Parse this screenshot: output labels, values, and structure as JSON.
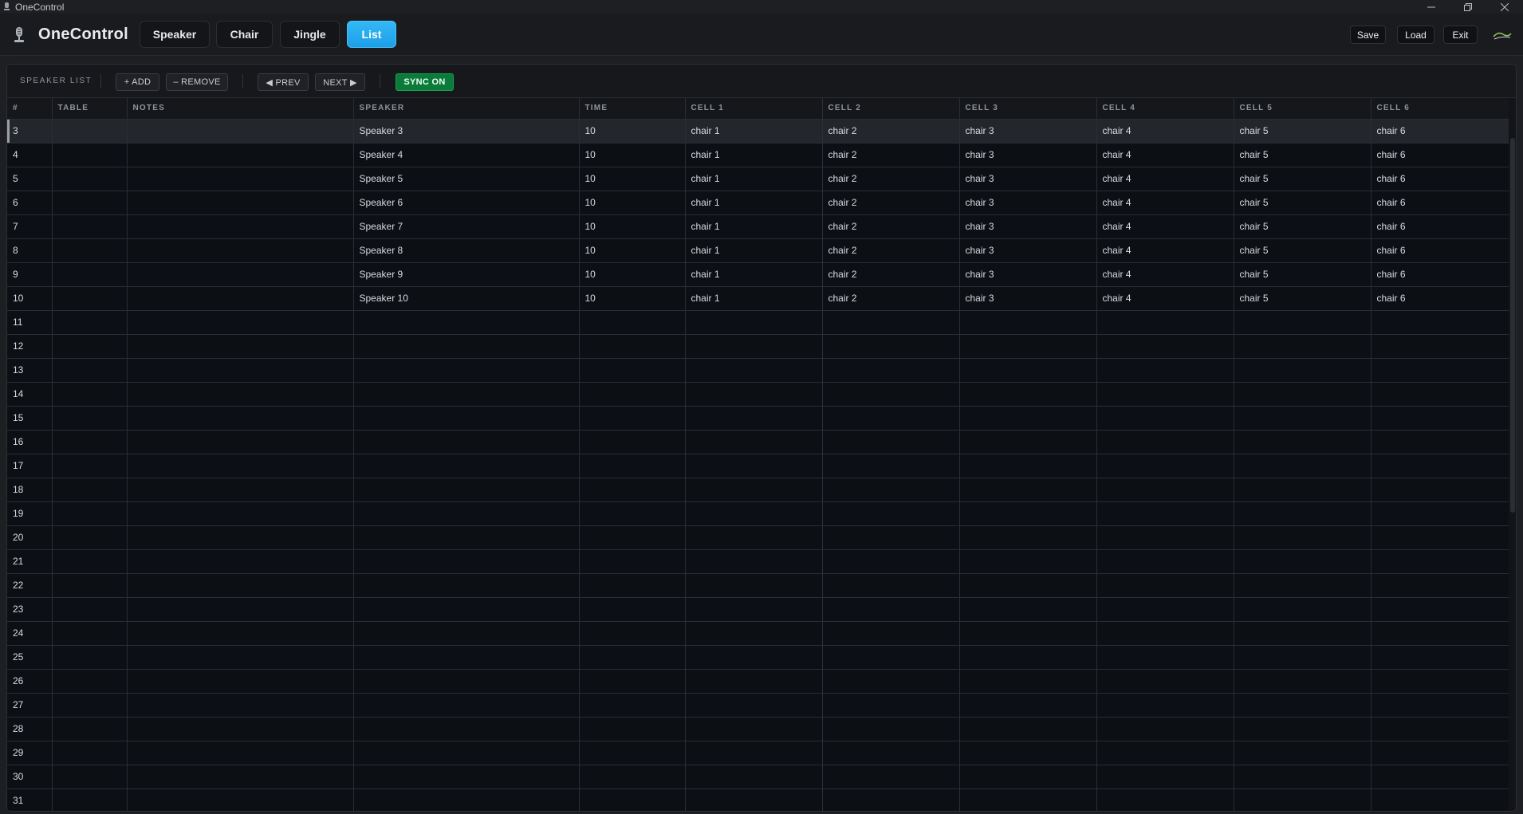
{
  "window": {
    "title": "OneControl",
    "controls": [
      "minimize-icon",
      "restore-icon",
      "close-icon"
    ]
  },
  "header": {
    "brand": "OneControl",
    "tabs": [
      {
        "label": "Speaker",
        "active": false
      },
      {
        "label": "Chair",
        "active": false
      },
      {
        "label": "Jingle",
        "active": false
      },
      {
        "label": "List",
        "active": true
      }
    ],
    "actions": {
      "save": "Save",
      "load": "Load",
      "exit": "Exit"
    }
  },
  "toolbar": {
    "label": "SPEAKER LIST",
    "add": "+ ADD",
    "remove": "– REMOVE",
    "prev": "◀ PREV",
    "next": "NEXT ▶",
    "sync": "SYNC ON"
  },
  "table": {
    "columns": [
      "#",
      "TABLE",
      "NOTES",
      "SPEAKER",
      "TIME",
      "CELL 1",
      "CELL 2",
      "CELL 3",
      "CELL 4",
      "CELL 5",
      "CELL 6"
    ],
    "selected_row": 0,
    "rows": [
      [
        "3",
        "",
        "",
        "Speaker 3",
        "10",
        "chair 1",
        "chair 2",
        "chair 3",
        "chair 4",
        "chair 5",
        "chair 6"
      ],
      [
        "4",
        "",
        "",
        "Speaker 4",
        "10",
        "chair 1",
        "chair 2",
        "chair 3",
        "chair 4",
        "chair 5",
        "chair 6"
      ],
      [
        "5",
        "",
        "",
        "Speaker 5",
        "10",
        "chair 1",
        "chair 2",
        "chair 3",
        "chair 4",
        "chair 5",
        "chair 6"
      ],
      [
        "6",
        "",
        "",
        "Speaker 6",
        "10",
        "chair 1",
        "chair 2",
        "chair 3",
        "chair 4",
        "chair 5",
        "chair 6"
      ],
      [
        "7",
        "",
        "",
        "Speaker 7",
        "10",
        "chair 1",
        "chair 2",
        "chair 3",
        "chair 4",
        "chair 5",
        "chair 6"
      ],
      [
        "8",
        "",
        "",
        "Speaker 8",
        "10",
        "chair 1",
        "chair 2",
        "chair 3",
        "chair 4",
        "chair 5",
        "chair 6"
      ],
      [
        "9",
        "",
        "",
        "Speaker 9",
        "10",
        "chair 1",
        "chair 2",
        "chair 3",
        "chair 4",
        "chair 5",
        "chair 6"
      ],
      [
        "10",
        "",
        "",
        "Speaker 10",
        "10",
        "chair 1",
        "chair 2",
        "chair 3",
        "chair 4",
        "chair 5",
        "chair 6"
      ],
      [
        "11",
        "",
        "",
        "",
        "",
        "",
        "",
        "",
        "",
        "",
        ""
      ],
      [
        "12",
        "",
        "",
        "",
        "",
        "",
        "",
        "",
        "",
        "",
        ""
      ],
      [
        "13",
        "",
        "",
        "",
        "",
        "",
        "",
        "",
        "",
        "",
        ""
      ],
      [
        "14",
        "",
        "",
        "",
        "",
        "",
        "",
        "",
        "",
        "",
        ""
      ],
      [
        "15",
        "",
        "",
        "",
        "",
        "",
        "",
        "",
        "",
        "",
        ""
      ],
      [
        "16",
        "",
        "",
        "",
        "",
        "",
        "",
        "",
        "",
        "",
        ""
      ],
      [
        "17",
        "",
        "",
        "",
        "",
        "",
        "",
        "",
        "",
        "",
        ""
      ],
      [
        "18",
        "",
        "",
        "",
        "",
        "",
        "",
        "",
        "",
        "",
        ""
      ],
      [
        "19",
        "",
        "",
        "",
        "",
        "",
        "",
        "",
        "",
        "",
        ""
      ],
      [
        "20",
        "",
        "",
        "",
        "",
        "",
        "",
        "",
        "",
        "",
        ""
      ],
      [
        "21",
        "",
        "",
        "",
        "",
        "",
        "",
        "",
        "",
        "",
        ""
      ],
      [
        "22",
        "",
        "",
        "",
        "",
        "",
        "",
        "",
        "",
        "",
        ""
      ],
      [
        "23",
        "",
        "",
        "",
        "",
        "",
        "",
        "",
        "",
        "",
        ""
      ],
      [
        "24",
        "",
        "",
        "",
        "",
        "",
        "",
        "",
        "",
        "",
        ""
      ],
      [
        "25",
        "",
        "",
        "",
        "",
        "",
        "",
        "",
        "",
        "",
        ""
      ],
      [
        "26",
        "",
        "",
        "",
        "",
        "",
        "",
        "",
        "",
        "",
        ""
      ],
      [
        "27",
        "",
        "",
        "",
        "",
        "",
        "",
        "",
        "",
        "",
        ""
      ],
      [
        "28",
        "",
        "",
        "",
        "",
        "",
        "",
        "",
        "",
        "",
        ""
      ],
      [
        "29",
        "",
        "",
        "",
        "",
        "",
        "",
        "",
        "",
        "",
        ""
      ],
      [
        "30",
        "",
        "",
        "",
        "",
        "",
        "",
        "",
        "",
        "",
        ""
      ],
      [
        "31",
        "",
        "",
        "",
        "",
        "",
        "",
        "",
        "",
        "",
        ""
      ]
    ]
  },
  "colors": {
    "accent": "#1d9fe8",
    "sync": "#0b7a3a",
    "background": "#0c0f14"
  }
}
